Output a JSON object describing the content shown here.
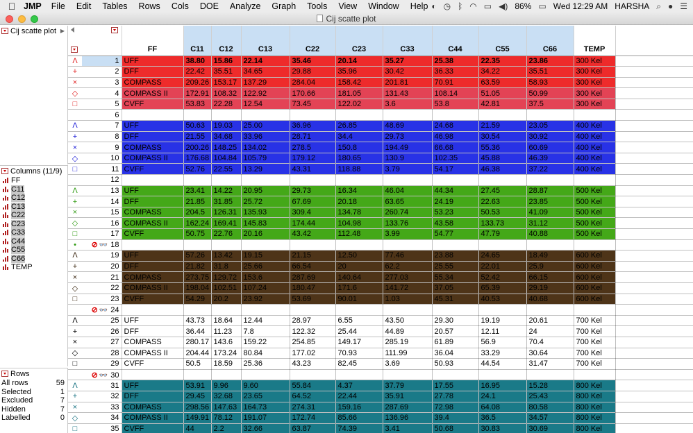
{
  "menubar": {
    "app_name": "JMP",
    "menus": [
      "File",
      "Edit",
      "Tables",
      "Rows",
      "Cols",
      "DOE",
      "Analyze",
      "Graph",
      "Tools",
      "View",
      "Window",
      "Help"
    ],
    "battery": "86%",
    "clock": "Wed 12:29 AM",
    "user": "HARSHA"
  },
  "window": {
    "title": "Cij scatte plot"
  },
  "table_panel": {
    "title": "Cij scatte plot"
  },
  "columns_panel": {
    "title": "Columns (11/9)",
    "items": [
      "FF",
      "C11",
      "C12",
      "C13",
      "C22",
      "C23",
      "C33",
      "C44",
      "C55",
      "C66",
      "TEMP"
    ],
    "selected": [
      "C11",
      "C12",
      "C13",
      "C22",
      "C23",
      "C33",
      "C44",
      "C55",
      "C66"
    ]
  },
  "rows_panel": {
    "title": "Rows",
    "stats": [
      {
        "label": "All rows",
        "value": "59"
      },
      {
        "label": "Selected",
        "value": "1"
      },
      {
        "label": "Excluded",
        "value": "7"
      },
      {
        "label": "Hidden",
        "value": "7"
      },
      {
        "label": "Labelled",
        "value": "0"
      }
    ]
  },
  "grid": {
    "columns": [
      "FF",
      "C11",
      "C12",
      "C13",
      "C22",
      "C23",
      "C33",
      "C44",
      "C55",
      "C66",
      "TEMP"
    ],
    "group_colors": {
      "300": {
        "bg": "#ee2b2b",
        "bg_alt": "#e34355",
        "marker": "#e02020"
      },
      "400": {
        "bg": "#2832e6",
        "marker": "#2020d8"
      },
      "500": {
        "bg": "#44a818",
        "marker": "#2e9a10"
      },
      "600": {
        "bg": "#4e3418",
        "marker": "#3a2610"
      },
      "700": {
        "bg": "#ffffff",
        "marker": "#000000"
      },
      "800": {
        "bg": "#1a7a88",
        "marker": "#157080"
      }
    },
    "rows": [
      {
        "n": "1",
        "m": "Λ",
        "g": "300",
        "sel": true,
        "cells": [
          "UFF",
          "38.80",
          "15.86",
          "22.14",
          "35.46",
          "20.14",
          "35.27",
          "25.38",
          "22.35",
          "23.86",
          "300 Kel"
        ]
      },
      {
        "n": "2",
        "m": "+",
        "g": "300",
        "cells": [
          "DFF",
          "22.42",
          "35.51",
          "34.65",
          "29.88",
          "35.96",
          "30.42",
          "36.33",
          "34.22",
          "35.51",
          "300 Kel"
        ]
      },
      {
        "n": "3",
        "m": "×",
        "g": "300",
        "cells": [
          "COMPASS",
          "209.26",
          "153.17",
          "137.29",
          "284.04",
          "158.42",
          "201.81",
          "70.91",
          "63.59",
          "58.93",
          "300 Kel"
        ]
      },
      {
        "n": "4",
        "m": "◇",
        "g": "300a",
        "cells": [
          "COMPASS II",
          "172.91",
          "108.32",
          "122.92",
          "170.66",
          "181.05",
          "131.43",
          "108.14",
          "51.05",
          "50.99",
          "300 Kel"
        ]
      },
      {
        "n": "5",
        "m": "□",
        "g": "300a",
        "cells": [
          "CVFF",
          "53.83",
          "22.28",
          "12.54",
          "73.45",
          "122.02",
          "3.6",
          "53.8",
          "42.81",
          "37.5",
          "300 Kel"
        ]
      },
      {
        "n": "6",
        "m": "",
        "g": "blank",
        "cells": [
          "",
          "",
          "",
          "",
          "",
          "",
          "",
          "",
          "",
          "",
          ""
        ]
      },
      {
        "n": "7",
        "m": "Λ",
        "g": "400",
        "cells": [
          "UFF",
          "50.63",
          "19.03",
          "25.00",
          "36.96",
          "26.85",
          "48.69",
          "24.68",
          "21.59",
          "23.05",
          "400 Kel"
        ]
      },
      {
        "n": "8",
        "m": "+",
        "g": "400",
        "cells": [
          "DFF",
          "21.55",
          "34.68",
          "33.96",
          "28.71",
          "34.4",
          "29.73",
          "46.98",
          "30.54",
          "30.92",
          "400 Kel"
        ]
      },
      {
        "n": "9",
        "m": "×",
        "g": "400",
        "cells": [
          "COMPASS",
          "200.26",
          "148.25",
          "134.02",
          "278.5",
          "150.8",
          "194.49",
          "66.68",
          "55.36",
          "60.69",
          "400 Kel"
        ]
      },
      {
        "n": "10",
        "m": "◇",
        "g": "400",
        "cells": [
          "COMPASS II",
          "176.68",
          "104.84",
          "105.79",
          "179.12",
          "180.65",
          "130.9",
          "102.35",
          "45.88",
          "46.39",
          "400 Kel"
        ]
      },
      {
        "n": "11",
        "m": "□",
        "g": "400",
        "cells": [
          "CVFF",
          "52.76",
          "22.55",
          "13.29",
          "43.31",
          "118.88",
          "3.79",
          "54.17",
          "46.38",
          "37.22",
          "400 Kel"
        ]
      },
      {
        "n": "12",
        "m": "",
        "g": "blank",
        "cells": [
          "",
          "",
          "",
          "",
          "",
          "",
          "",
          "",
          "",
          "",
          ""
        ]
      },
      {
        "n": "13",
        "m": "Λ",
        "g": "500",
        "cells": [
          "UFF",
          "23.41",
          "14.22",
          "20.95",
          "29.73",
          "16.34",
          "46.04",
          "44.34",
          "27.45",
          "28.87",
          "500 Kel"
        ]
      },
      {
        "n": "14",
        "m": "+",
        "g": "500",
        "cells": [
          "DFF",
          "21.85",
          "31.85",
          "25.72",
          "67.69",
          "20.18",
          "63.65",
          "24.19",
          "22.63",
          "23.85",
          "500 Kel"
        ]
      },
      {
        "n": "15",
        "m": "×",
        "g": "500",
        "cells": [
          "COMPASS",
          "204.5",
          "126.31",
          "135.93",
          "309.4",
          "134.78",
          "260.74",
          "53.23",
          "50.53",
          "41.09",
          "500 Kel"
        ]
      },
      {
        "n": "16",
        "m": "◇",
        "g": "500",
        "cells": [
          "COMPASS II",
          "162.24",
          "169.41",
          "145.83",
          "174.44",
          "104.98",
          "133.76",
          "43.58",
          "133.73",
          "31.12",
          "500 Kel"
        ]
      },
      {
        "n": "17",
        "m": "□",
        "g": "500",
        "cells": [
          "CVFF",
          "50.75",
          "22.76",
          "20.16",
          "43.42",
          "112.48",
          "3.99",
          "54.77",
          "47.79",
          "40.88",
          "500 Kel"
        ]
      },
      {
        "n": "18",
        "m": "•",
        "g": "blank500",
        "excl": true,
        "cells": [
          "",
          "",
          "",
          "",
          "",
          "",
          "",
          "",
          "",
          "",
          ""
        ]
      },
      {
        "n": "19",
        "m": "Λ",
        "g": "600",
        "cells": [
          "UFF",
          "57.26",
          "13.42",
          "19.15",
          "21.15",
          "12.50",
          "77.46",
          "23.88",
          "24.65",
          "18.49",
          "600 Kel"
        ]
      },
      {
        "n": "20",
        "m": "+",
        "g": "600",
        "cells": [
          "DFF",
          "21.82",
          "31.8",
          "25.66",
          "66.54",
          "20",
          "62.2",
          "25.55",
          "22.01",
          "25.9",
          "600 Kel"
        ]
      },
      {
        "n": "21",
        "m": "×",
        "g": "600",
        "cells": [
          "COMPASS",
          "273.75",
          "129.72",
          "153.6",
          "287.69",
          "140.64",
          "277.03",
          "55.34",
          "52.42",
          "66.15",
          "600 Kel"
        ]
      },
      {
        "n": "22",
        "m": "◇",
        "g": "600",
        "cells": [
          "COMPASS II",
          "198.04",
          "102.51",
          "107.24",
          "180.47",
          "171.6",
          "141.72",
          "37.05",
          "65.39",
          "29.19",
          "600 Kel"
        ]
      },
      {
        "n": "23",
        "m": "□",
        "g": "600",
        "cells": [
          "CVFF",
          "54.29",
          "20.2",
          "23.92",
          "53.69",
          "90.01",
          "1.03",
          "45.31",
          "40.53",
          "40.68",
          "600 Kel"
        ]
      },
      {
        "n": "24",
        "m": "",
        "g": "blank",
        "excl": true,
        "cells": [
          "",
          "",
          "",
          "",
          "",
          "",
          "",
          "",
          "",
          "",
          ""
        ]
      },
      {
        "n": "25",
        "m": "Λ",
        "g": "700",
        "cells": [
          "UFF",
          "43.73",
          "18.64",
          "12.44",
          "28.97",
          "6.55",
          "43.50",
          "29.30",
          "19.19",
          "20.61",
          "700 Kel"
        ]
      },
      {
        "n": "26",
        "m": "+",
        "g": "700",
        "cells": [
          "DFF",
          "36.44",
          "11.23",
          "7.8",
          "122.32",
          "25.44",
          "44.89",
          "20.57",
          "12.11",
          "24",
          "700 Kel"
        ]
      },
      {
        "n": "27",
        "m": "×",
        "g": "700",
        "cells": [
          "COMPASS",
          "280.17",
          "143.6",
          "159.22",
          "254.85",
          "149.17",
          "285.19",
          "61.89",
          "56.9",
          "70.4",
          "700 Kel"
        ]
      },
      {
        "n": "28",
        "m": "◇",
        "g": "700",
        "cells": [
          "COMPASS II",
          "204.44",
          "173.24",
          "80.84",
          "177.02",
          "70.93",
          "111.99",
          "36.04",
          "33.29",
          "30.64",
          "700 Kel"
        ]
      },
      {
        "n": "29",
        "m": "□",
        "g": "700",
        "cells": [
          "CVFF",
          "50.5",
          "18.59",
          "25.36",
          "43.23",
          "82.45",
          "3.69",
          "50.93",
          "44.54",
          "31.47",
          "700 Kel"
        ]
      },
      {
        "n": "30",
        "m": "",
        "g": "blank",
        "excl": true,
        "cells": [
          "",
          "",
          "",
          "",
          "",
          "",
          "",
          "",
          "",
          "",
          ""
        ]
      },
      {
        "n": "31",
        "m": "Λ",
        "g": "800",
        "cells": [
          "UFF",
          "53.91",
          "9.96",
          "9.60",
          "55.84",
          "4.37",
          "37.79",
          "17.55",
          "16.95",
          "15.28",
          "800 Kel"
        ]
      },
      {
        "n": "32",
        "m": "+",
        "g": "800",
        "cells": [
          "DFF",
          "29.45",
          "32.68",
          "23.65",
          "64.52",
          "22.44",
          "35.91",
          "27.78",
          "24.1",
          "25.43",
          "800 Kel"
        ]
      },
      {
        "n": "33",
        "m": "×",
        "g": "800",
        "cells": [
          "COMPASS",
          "298.56",
          "147.63",
          "164.73",
          "274.31",
          "159.16",
          "287.69",
          "72.98",
          "64.08",
          "80.58",
          "800 Kel"
        ]
      },
      {
        "n": "34",
        "m": "◇",
        "g": "800",
        "cells": [
          "COMPASS II",
          "149.91",
          "78.12",
          "191.07",
          "172.74",
          "85.66",
          "136.96",
          "39.4",
          "36.5",
          "34.57",
          "800 Kel"
        ]
      },
      {
        "n": "35",
        "m": "□",
        "g": "800",
        "cells": [
          "CVFF",
          "44",
          "2.2",
          "32.66",
          "63.87",
          "74.39",
          "3.41",
          "50.68",
          "30.83",
          "30.69",
          "800 Kel"
        ]
      }
    ]
  }
}
